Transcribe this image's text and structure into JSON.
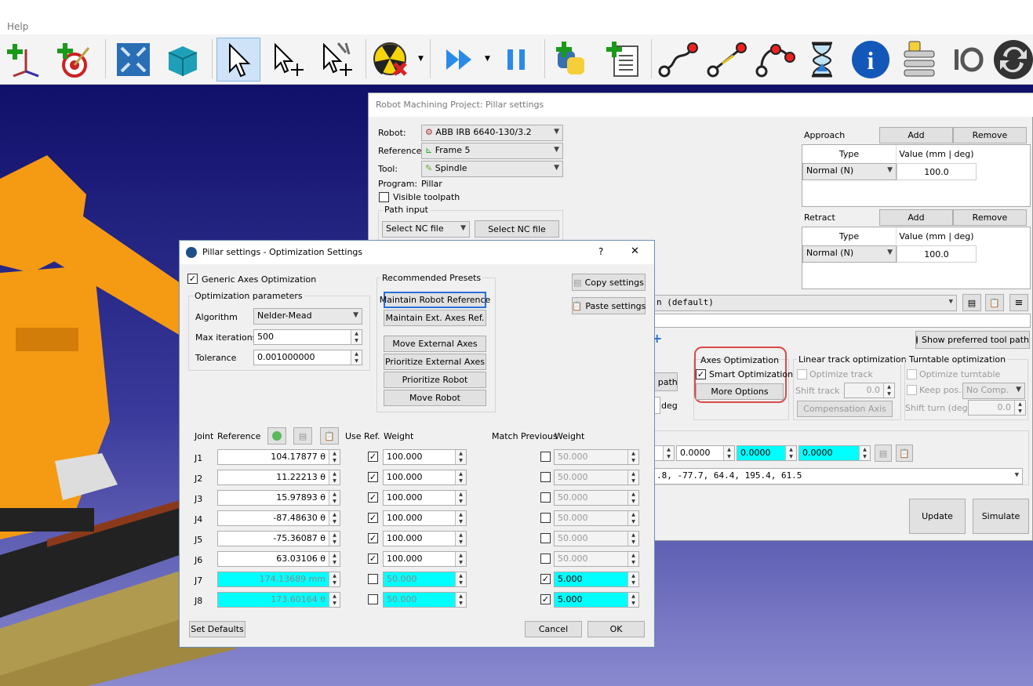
{
  "menu": {
    "help": "Help"
  },
  "toolbar": {
    "icons": [
      "add-reference-frame-icon",
      "add-target-icon",
      "fit-all-icon",
      "box-view-icon",
      "select-icon",
      "move-reference-icon",
      "move-tool-icon",
      "collision-icon",
      "run-program-icon",
      "pause-icon",
      "python-icon",
      "add-program-icon",
      "joint-move-icon",
      "linear-move-icon",
      "circular-move-icon",
      "pause-instruction-icon",
      "info-icon",
      "program-call-icon",
      "io-icon",
      "refresh-icon"
    ]
  },
  "main_window": {
    "title": "Robot Machining Project: Pillar settings",
    "robot_label": "Robot:",
    "robot_value": "ABB IRB 6640-130/3.2",
    "reference_label": "Reference:",
    "reference_value": "Frame 5",
    "tool_label": "Tool:",
    "tool_value": "Spindle",
    "program_label": "Program:",
    "program_value": "Pillar",
    "visible_toolpath": "Visible toolpath",
    "path_input": "Path input",
    "path_combo": "Select NC file",
    "path_button": "Select NC file",
    "approach": {
      "label": "Approach",
      "add": "Add",
      "remove": "Remove",
      "col_type": "Type",
      "col_value": "Value (mm | deg)",
      "type": "Normal (N)",
      "value": "100.0"
    },
    "retract": {
      "label": "Retract",
      "add": "Add",
      "remove": "Remove",
      "col_type": "Type",
      "col_value": "Value (mm | deg)",
      "type": "Normal (N)",
      "value": "100.0"
    },
    "method_combo": "n (default)",
    "show_preferred": "Show preferred tool path",
    "path_partial": "l path",
    "deg": "deg",
    "axes_opt": {
      "title": "Axes Optimization",
      "smart": "Smart Optimization",
      "more": "More Options"
    },
    "linear_track": {
      "title": "Linear track optimization",
      "optimize": "Optimize track",
      "shift": "Shift track",
      "shift_value": "0.0",
      "comp": "Compensation Axis"
    },
    "turntable": {
      "title": "Turntable optimization",
      "optimize": "Optimize turntable",
      "keep": "Keep pos.",
      "keep_value": "No Comp.",
      "shift": "Shift turn (deg)",
      "shift_value": "0.0"
    },
    "joint_row": [
      "0.0000",
      "0.0000",
      "0.0000"
    ],
    "joints_text": ".8,   -77.7,    64.4,   195.4,    61.5",
    "update": "Update",
    "simulate": "Simulate"
  },
  "dialog": {
    "title": "Pillar settings - Optimization Settings",
    "help": "?",
    "close": "✕",
    "generic": "Generic Axes Optimization",
    "params_title": "Optimization parameters",
    "algorithm_label": "Algorithm",
    "algorithm_value": "Nelder-Mead",
    "maxiter_label": "Max iterations",
    "maxiter_value": "500",
    "tolerance_label": "Tolerance",
    "tolerance_value": "0.001000000",
    "presets_title": "Recommended Presets",
    "presets": [
      "Maintain Robot Reference",
      "Maintain Ext. Axes Ref.",
      "Move External Axes",
      "Prioritize External Axes",
      "Prioritize Robot",
      "Move Robot"
    ],
    "copy": "Copy settings",
    "paste": "Paste settings",
    "col_joint": "Joint",
    "col_reference": "Reference",
    "col_useref": "Use Ref.",
    "col_weight": "Weight",
    "col_match": "Match Previous",
    "col_weight2": "Weight",
    "joints": [
      {
        "name": "J1",
        "ref": "104.17877 θ",
        "use": true,
        "weight": "100.000",
        "match": false,
        "mweight": "50.000"
      },
      {
        "name": "J2",
        "ref": "11.22213 θ",
        "use": true,
        "weight": "100.000",
        "match": false,
        "mweight": "50.000"
      },
      {
        "name": "J3",
        "ref": "15.97893 θ",
        "use": true,
        "weight": "100.000",
        "match": false,
        "mweight": "50.000"
      },
      {
        "name": "J4",
        "ref": "-87.48630 θ",
        "use": true,
        "weight": "100.000",
        "match": false,
        "mweight": "50.000"
      },
      {
        "name": "J5",
        "ref": "-75.36087 θ",
        "use": true,
        "weight": "100.000",
        "match": false,
        "mweight": "50.000"
      },
      {
        "name": "J6",
        "ref": "63.03106 θ",
        "use": true,
        "weight": "100.000",
        "match": false,
        "mweight": "50.000"
      },
      {
        "name": "J7",
        "ref": "174.13689 mm",
        "use": false,
        "weight": "50.000",
        "match": true,
        "mweight": "5.000"
      },
      {
        "name": "J8",
        "ref": "173.60164 θ",
        "use": false,
        "weight": "50.000",
        "match": true,
        "mweight": "5.000"
      }
    ],
    "set_defaults": "Set Defaults",
    "cancel": "Cancel",
    "ok": "OK"
  },
  "colors": {
    "accent_cyan": "#00ffff",
    "highlight_red": "#d94a4a",
    "robot_orange": "#f59a13",
    "viewport_blue": "#1a1a7a"
  }
}
